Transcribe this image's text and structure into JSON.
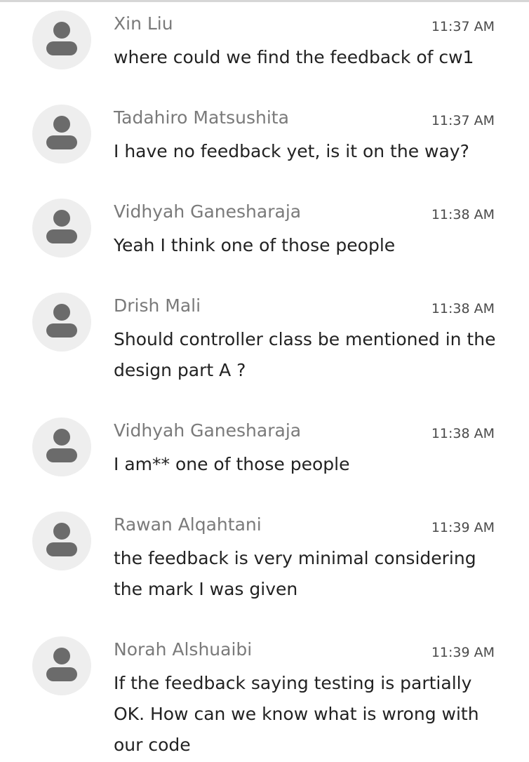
{
  "messages": [
    {
      "author": "Xin Liu",
      "time": "11:37 AM",
      "text": "where could we find the feedback of cw1"
    },
    {
      "author": "Tadahiro Matsushita",
      "time": "11:37 AM",
      "text": "I have no feedback yet, is it on the way?"
    },
    {
      "author": "Vidhyah Ganesharaja",
      "time": "11:38 AM",
      "text": "Yeah I think one of those people"
    },
    {
      "author": "Drish Mali",
      "time": "11:38 AM",
      "text": "Should controller class be mentioned in the design part A ?"
    },
    {
      "author": "Vidhyah Ganesharaja",
      "time": "11:38 AM",
      "text": "I am** one of those people"
    },
    {
      "author": "Rawan Alqahtani",
      "time": "11:39 AM",
      "text": "the feedback is very minimal considering the mark I was given"
    },
    {
      "author": "Norah Alshuaibi",
      "time": "11:39 AM",
      "text": "If the feedback saying testing is partially OK. How can we know what is wrong with our code"
    }
  ],
  "avatar_icon": "default-user-icon",
  "colors": {
    "avatar_bg": "#eeeeee",
    "avatar_figure": "#6b6b6b",
    "author": "#7a7a7a",
    "time": "#4a4a4a",
    "text": "#222222"
  }
}
